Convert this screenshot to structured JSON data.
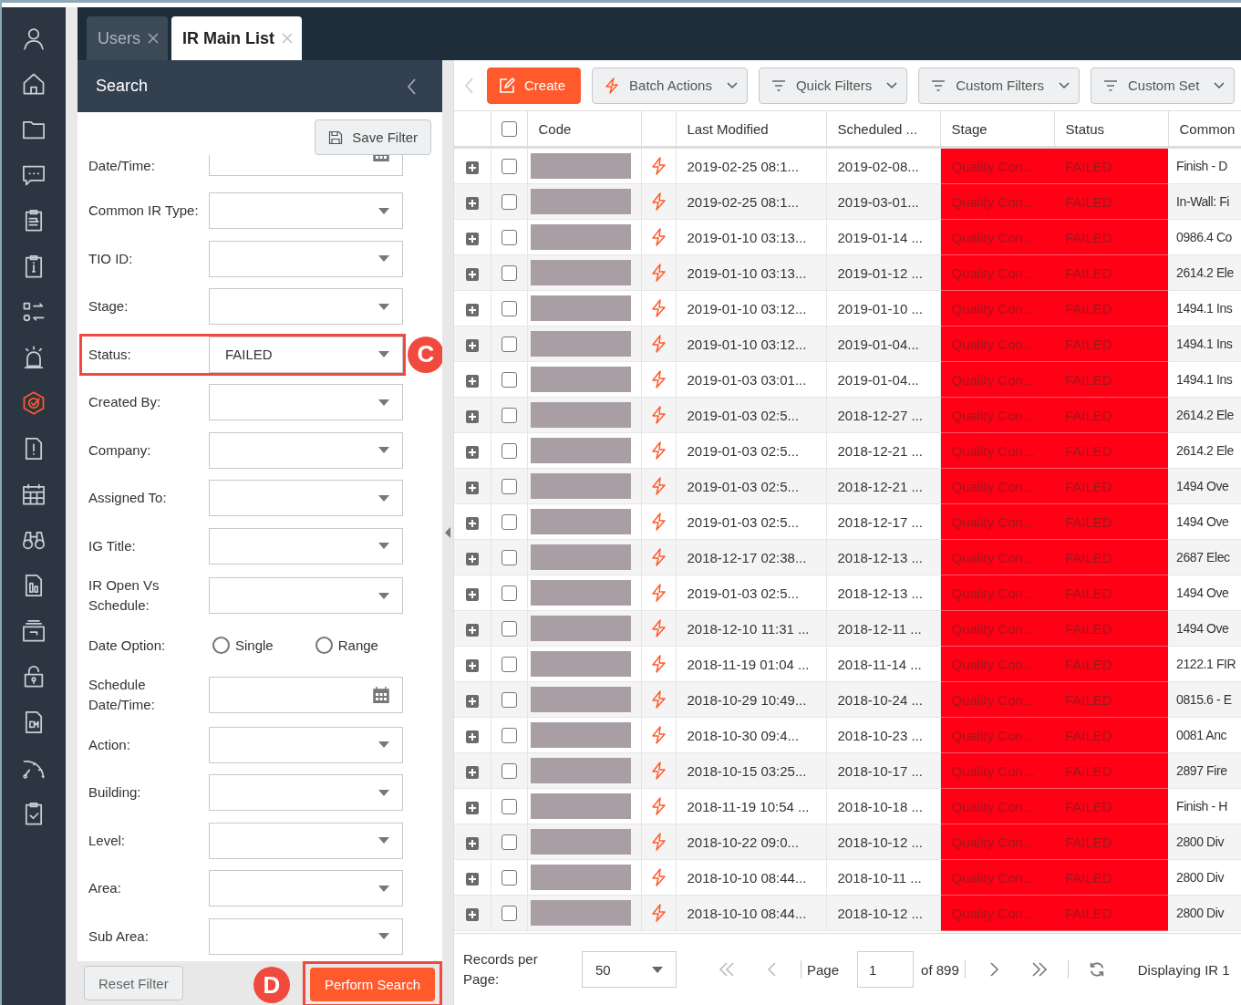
{
  "sidebar": {
    "items": [
      {
        "kind": "user",
        "selected": false
      },
      {
        "kind": "home",
        "selected": false
      },
      {
        "kind": "folder",
        "selected": false
      },
      {
        "kind": "chat",
        "selected": false
      },
      {
        "kind": "list",
        "selected": false
      },
      {
        "kind": "info",
        "selected": false
      },
      {
        "kind": "transfer",
        "selected": false
      },
      {
        "kind": "alarm",
        "selected": false
      },
      {
        "kind": "target",
        "selected": true
      },
      {
        "kind": "alert",
        "selected": false
      },
      {
        "kind": "calendar",
        "selected": false
      },
      {
        "kind": "binoculars",
        "selected": false
      },
      {
        "kind": "report",
        "selected": false
      },
      {
        "kind": "archive",
        "selected": false
      },
      {
        "kind": "lock",
        "selected": false
      },
      {
        "kind": "cm",
        "selected": false
      },
      {
        "kind": "gauge",
        "selected": false
      },
      {
        "kind": "check",
        "selected": false
      }
    ]
  },
  "tabs": [
    {
      "label": "Users",
      "selected": false
    },
    {
      "label": "IR Main List",
      "selected": true
    }
  ],
  "search_panel": {
    "title": "Search",
    "save_button": "Save Filter",
    "fields": [
      {
        "kind": "date",
        "label": "Date/Time:",
        "partial": true
      },
      {
        "kind": "select",
        "label": "Common IR Type:"
      },
      {
        "kind": "select",
        "label": "TIO ID:"
      },
      {
        "kind": "select",
        "label": "Stage:"
      },
      {
        "kind": "select",
        "label": "Status:",
        "value": "FAILED",
        "callout": "C"
      },
      {
        "kind": "select",
        "label": "Created By:"
      },
      {
        "kind": "select",
        "label": "Company:"
      },
      {
        "kind": "select",
        "label": "Assigned To:"
      },
      {
        "kind": "select",
        "label": "IG Title:"
      },
      {
        "kind": "select",
        "label": "IR Open Vs Schedule:"
      },
      {
        "kind": "radio",
        "label": "Date Option:",
        "options": [
          {
            "label": "Single",
            "selected": false
          },
          {
            "label": "Range",
            "selected": false
          }
        ]
      },
      {
        "kind": "date",
        "label": "Schedule Date/Time:"
      },
      {
        "kind": "select",
        "label": "Action:"
      },
      {
        "kind": "select",
        "label": "Building:"
      },
      {
        "kind": "select",
        "label": "Level:"
      },
      {
        "kind": "select",
        "label": "Area:"
      },
      {
        "kind": "select",
        "label": "Sub Area:"
      }
    ],
    "reset_button": "Reset Filter",
    "search_button": {
      "label": "Perform Search",
      "callout": "D"
    }
  },
  "toolbar": [
    {
      "kind": "primary",
      "label": "Create"
    },
    {
      "kind": "batch",
      "label": "Batch Actions"
    },
    {
      "kind": "filter",
      "label": "Quick Filters"
    },
    {
      "kind": "filter",
      "label": "Custom Filters"
    },
    {
      "kind": "filter",
      "label": "Custom Set"
    }
  ],
  "table": {
    "header_checked": false,
    "columns": [
      "Code",
      "Last Modified",
      "Scheduled ...",
      "Stage",
      "Status",
      "Common"
    ],
    "rows": [
      {
        "checked": false,
        "flagged": true,
        "last_modified": "2019-02-25 08:1...",
        "scheduled": "2019-02-08...",
        "stage": "Quality Con...",
        "status": "FAILED",
        "common": "Finish - D"
      },
      {
        "checked": false,
        "flagged": true,
        "last_modified": "2019-02-25 08:1...",
        "scheduled": "2019-03-01...",
        "stage": "Quality Con...",
        "status": "FAILED",
        "common": "In-Wall: Fi"
      },
      {
        "checked": false,
        "flagged": true,
        "last_modified": "2019-01-10 03:13...",
        "scheduled": "2019-01-14 ...",
        "stage": "Quality Con...",
        "status": "FAILED",
        "common": "0986.4 Co"
      },
      {
        "checked": false,
        "flagged": true,
        "last_modified": "2019-01-10 03:13...",
        "scheduled": "2019-01-12 ...",
        "stage": "Quality Con...",
        "status": "FAILED",
        "common": "2614.2 Ele"
      },
      {
        "checked": false,
        "flagged": true,
        "last_modified": "2019-01-10 03:12...",
        "scheduled": "2019-01-10 ...",
        "stage": "Quality Con...",
        "status": "FAILED",
        "common": "1494.1 Ins"
      },
      {
        "checked": false,
        "flagged": true,
        "last_modified": "2019-01-10 03:12...",
        "scheduled": "2019-01-04...",
        "stage": "Quality Con...",
        "status": "FAILED",
        "common": "1494.1 Ins"
      },
      {
        "checked": false,
        "flagged": true,
        "last_modified": "2019-01-03 03:01...",
        "scheduled": "2019-01-04...",
        "stage": "Quality Con...",
        "status": "FAILED",
        "common": "1494.1 Ins"
      },
      {
        "checked": false,
        "flagged": true,
        "last_modified": "2019-01-03 02:5...",
        "scheduled": "2018-12-27 ...",
        "stage": "Quality Con...",
        "status": "FAILED",
        "common": "2614.2 Ele"
      },
      {
        "checked": false,
        "flagged": true,
        "last_modified": "2019-01-03 02:5...",
        "scheduled": "2018-12-21 ...",
        "stage": "Quality Con...",
        "status": "FAILED",
        "common": "2614.2 Ele"
      },
      {
        "checked": false,
        "flagged": true,
        "last_modified": "2019-01-03 02:5...",
        "scheduled": "2018-12-21 ...",
        "stage": "Quality Con...",
        "status": "FAILED",
        "common": "1494 Ove"
      },
      {
        "checked": false,
        "flagged": true,
        "last_modified": "2019-01-03 02:5...",
        "scheduled": "2018-12-17 ...",
        "stage": "Quality Con...",
        "status": "FAILED",
        "common": "1494 Ove"
      },
      {
        "checked": false,
        "flagged": true,
        "last_modified": "2018-12-17 02:38...",
        "scheduled": "2018-12-13 ...",
        "stage": "Quality Con...",
        "status": "FAILED",
        "common": "2687 Elec"
      },
      {
        "checked": false,
        "flagged": true,
        "last_modified": "2019-01-03 02:5...",
        "scheduled": "2018-12-13 ...",
        "stage": "Quality Con...",
        "status": "FAILED",
        "common": "1494 Ove"
      },
      {
        "checked": false,
        "flagged": true,
        "last_modified": "2018-12-10 11:31 ...",
        "scheduled": "2018-12-11 ...",
        "stage": "Quality Con...",
        "status": "FAILED",
        "common": "1494 Ove"
      },
      {
        "checked": false,
        "flagged": true,
        "last_modified": "2018-11-19 01:04 ...",
        "scheduled": "2018-11-14 ...",
        "stage": "Quality Con...",
        "status": "FAILED",
        "common": "2122.1 FIR"
      },
      {
        "checked": false,
        "flagged": true,
        "last_modified": "2018-10-29 10:49...",
        "scheduled": "2018-10-24 ...",
        "stage": "Quality Con...",
        "status": "FAILED",
        "common": "0815.6 - E"
      },
      {
        "checked": false,
        "flagged": true,
        "last_modified": "2018-10-30 09:4...",
        "scheduled": "2018-10-23 ...",
        "stage": "Quality Con...",
        "status": "FAILED",
        "common": "0081 Anc"
      },
      {
        "checked": false,
        "flagged": true,
        "last_modified": "2018-10-15 03:25...",
        "scheduled": "2018-10-17 ...",
        "stage": "Quality Con...",
        "status": "FAILED",
        "common": "2897 Fire"
      },
      {
        "checked": false,
        "flagged": true,
        "last_modified": "2018-11-19 10:54 ...",
        "scheduled": "2018-10-18 ...",
        "stage": "Quality Con...",
        "status": "FAILED",
        "common": "Finish - H"
      },
      {
        "checked": false,
        "flagged": true,
        "last_modified": "2018-10-22 09:0...",
        "scheduled": "2018-10-12 ...",
        "stage": "Quality Con...",
        "status": "FAILED",
        "common": "2800 Div"
      },
      {
        "checked": false,
        "flagged": true,
        "last_modified": "2018-10-10 08:44...",
        "scheduled": "2018-10-11 ...",
        "stage": "Quality Con...",
        "status": "FAILED",
        "common": "2800 Div"
      },
      {
        "checked": false,
        "flagged": true,
        "last_modified": "2018-10-10 08:44...",
        "scheduled": "2018-10-12 ...",
        "stage": "Quality Con...",
        "status": "FAILED",
        "common": "2800 Div"
      }
    ]
  },
  "pager": {
    "records_label": "Records per Page:",
    "per_page": "50",
    "page_label": "Page",
    "page": "1",
    "of_pages": "of 899",
    "displaying": "Displaying IR 1"
  }
}
